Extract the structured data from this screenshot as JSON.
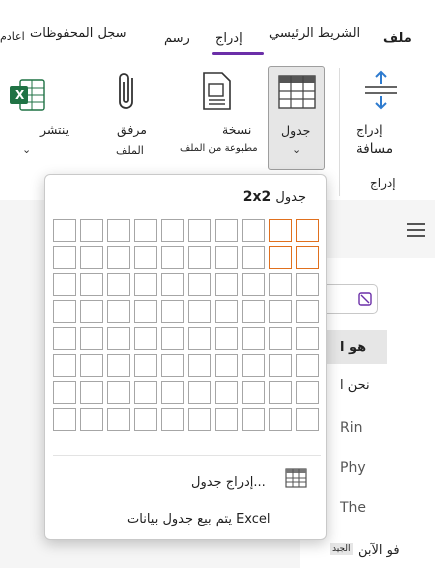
{
  "tabs": [
    {
      "label": "ملف"
    },
    {
      "label": "الشريط الرئيسي"
    },
    {
      "label": "إدراج"
    },
    {
      "label": "رسم"
    },
    {
      "label": "سجل المحفوظات"
    },
    {
      "label": "اعادم"
    }
  ],
  "ribbon": {
    "insert_space": {
      "line1": "إدراج",
      "line2": "مسافة"
    },
    "group_label": "إدراج",
    "table": {
      "label": "جدول"
    },
    "printout": {
      "line1": "نسخة",
      "line2": "مطبوعة من الملف"
    },
    "attach": {
      "line1": "مرفق",
      "line2": "الملف"
    },
    "spreadsheet": {
      "label": "ينتشر"
    },
    "excel_badge": "X"
  },
  "table_dropdown": {
    "title_label": "جدول",
    "title_size": "2x2",
    "grid": {
      "rows": 8,
      "cols": 10,
      "selected_rows": 2,
      "selected_cols": 2
    },
    "insert_table": "إدراج جدول...",
    "excel_table": "يتم بيع جدول بيانات Excel"
  },
  "notes": {
    "lines": [
      "هو ا",
      "نحن ا",
      "Rin",
      "Phy",
      "The",
      "فو الآبن"
    ],
    "small_label": "الجيد"
  },
  "colors": {
    "accent": "#6b2fa8",
    "selection": "#e0701e",
    "excel_green": "#1f7244"
  },
  "icons": [
    "insert-space-icon",
    "table-icon",
    "printout-icon",
    "paperclip-icon",
    "excel-icon",
    "chevron-down-icon",
    "hamburger-icon",
    "table-small-icon",
    "edit-icon"
  ]
}
